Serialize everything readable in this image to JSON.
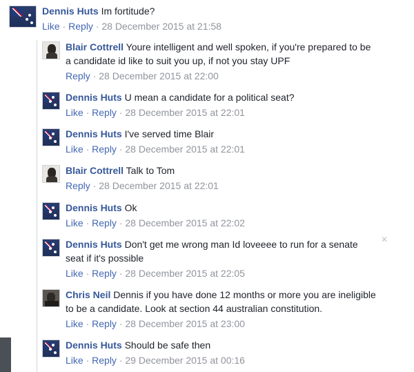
{
  "comments": [
    {
      "author": "Dennis Huts",
      "text": "Im fortitude?",
      "like": "Like",
      "reply": "Reply",
      "sep": "·",
      "date": "28 December 2015 at 21:58",
      "avatar_icon": "flag-avatar-icon"
    },
    {
      "author": "Blair Cottrell",
      "text": "Youre intelligent and well spoken, if you're prepared to be a candidate id like to suit you up, if not you stay UPF",
      "reply": "Reply",
      "sep": "·",
      "date": "28 December 2015 at 22:00",
      "avatar_icon": "person-avatar-icon"
    },
    {
      "author": "Dennis Huts",
      "text": "U mean a candidate for a political seat?",
      "like": "Like",
      "reply": "Reply",
      "sep": "·",
      "date": "28 December 2015 at 22:01",
      "avatar_icon": "flag-avatar-icon"
    },
    {
      "author": "Dennis Huts",
      "text": "I've served time Blair",
      "like": "Like",
      "reply": "Reply",
      "sep": "·",
      "date": "28 December 2015 at 22:01",
      "avatar_icon": "flag-avatar-icon"
    },
    {
      "author": "Blair Cottrell",
      "text": "Talk to Tom",
      "reply": "Reply",
      "sep": "·",
      "date": "28 December 2015 at 22:01",
      "avatar_icon": "person-avatar-icon"
    },
    {
      "author": "Dennis Huts",
      "text": "Ok",
      "like": "Like",
      "reply": "Reply",
      "sep": "·",
      "date": "28 December 2015 at 22:02",
      "avatar_icon": "flag-avatar-icon"
    },
    {
      "author": "Dennis Huts",
      "text": "Don't get me wrong man Id loveeee to run for a senate seat if it's possible",
      "like": "Like",
      "reply": "Reply",
      "sep": "·",
      "date": "28 December 2015 at 22:05",
      "avatar_icon": "flag-avatar-icon"
    },
    {
      "author": "Chris Neil",
      "text": "Dennis if you have done 12 months or more you are ineligible to be a candidate. Look at section 44 australian constitution.",
      "like": "Like",
      "reply": "Reply",
      "sep": "·",
      "date": "28 December 2015 at 23:00",
      "avatar_icon": "person-avatar-icon"
    },
    {
      "author": "Dennis Huts",
      "text": "Should be safe then",
      "like": "Like",
      "reply": "Reply",
      "sep": "·",
      "date": "29 December 2015 at 00:16",
      "avatar_icon": "flag-avatar-icon"
    }
  ],
  "close_icon": "close-icon",
  "close_glyph": "×",
  "colors": {
    "author": "#365899",
    "action": "#4267b2",
    "meta": "#90949c",
    "text": "#1d2129"
  }
}
